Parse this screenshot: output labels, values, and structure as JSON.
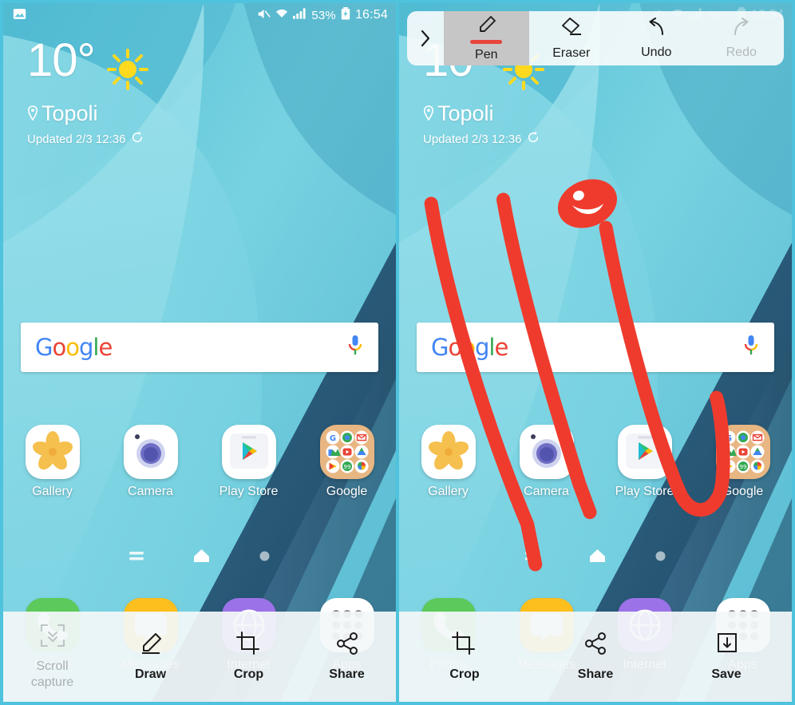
{
  "colors": {
    "accent_red": "#ef3b2d",
    "frame": "#4fc3dd",
    "toolbar_bg": "#f3f8f9",
    "selected_bg": "#c6c6c6",
    "pen_underline": "#e8453c",
    "wallpaper_base": "#63c6da"
  },
  "statusbar": {
    "gallery_icon": "image-icon",
    "mute_icon": "mute-icon",
    "wifi_icon": "wifi-icon",
    "signal_icon": "signal-bars-icon",
    "battery_percent": "53%",
    "battery_icon": "battery-charging-icon",
    "clock": "16:54"
  },
  "weather": {
    "temperature": "10°",
    "condition_icon": "sun-icon",
    "location_icon": "location-pin-icon",
    "location": "Topoli",
    "updated_label": "Updated 2/3  12:36",
    "refresh_icon": "refresh-icon"
  },
  "search": {
    "logo_letters": [
      "G",
      "o",
      "o",
      "g",
      "l",
      "e"
    ],
    "mic_icon": "microphone-icon"
  },
  "apps": [
    {
      "label": "Gallery",
      "icon": "gallery-flower-icon"
    },
    {
      "label": "Camera",
      "icon": "camera-lens-icon"
    },
    {
      "label": "Play Store",
      "icon": "play-store-icon"
    },
    {
      "label": "Google",
      "icon": "google-folder-icon"
    }
  ],
  "google_folder_apps": [
    "google-search-icon",
    "chrome-icon",
    "gmail-icon",
    "maps-icon",
    "youtube-icon",
    "drive-icon",
    "play-music-icon",
    "duo-icon",
    "photos-icon"
  ],
  "page_indicators": {
    "list_icon": "list-lines-icon",
    "home_icon": "home-icon",
    "dot_icon": "page-dot-icon"
  },
  "dock": [
    {
      "label": "Phone",
      "icon": "phone-icon"
    },
    {
      "label": "Messages",
      "icon": "messages-icon"
    },
    {
      "label": "Internet",
      "icon": "internet-globe-icon"
    },
    {
      "label": "Apps",
      "icon": "apps-grid-icon"
    }
  ],
  "left_panel": {
    "bottom_toolbar": [
      {
        "label": "Scroll\ncapture",
        "label_line1": "Scroll",
        "label_line2": "capture",
        "icon": "scroll-capture-icon",
        "enabled": false
      },
      {
        "label": "Draw",
        "icon": "draw-pen-icon",
        "enabled": true
      },
      {
        "label": "Crop",
        "icon": "crop-icon",
        "enabled": true
      },
      {
        "label": "Share",
        "icon": "share-icon",
        "enabled": true
      }
    ]
  },
  "right_panel": {
    "top_toolbar": {
      "expand_icon": "chevron-right-icon",
      "items": [
        {
          "label": "Pen",
          "icon": "pen-icon",
          "selected": true,
          "enabled": true
        },
        {
          "label": "Eraser",
          "icon": "eraser-icon",
          "selected": false,
          "enabled": true
        },
        {
          "label": "Undo",
          "icon": "undo-arrow-icon",
          "selected": false,
          "enabled": true
        },
        {
          "label": "Redo",
          "icon": "redo-arrow-icon",
          "selected": false,
          "enabled": false
        }
      ]
    },
    "bottom_toolbar": [
      {
        "label": "Crop",
        "icon": "crop-icon",
        "enabled": true
      },
      {
        "label": "Share",
        "icon": "share-icon",
        "enabled": true
      },
      {
        "label": "Save",
        "icon": "save-download-icon",
        "enabled": true
      }
    ],
    "annotation": {
      "tool": "Pen",
      "color": "#ef3b2d",
      "strokes": [
        "diagonal-stroke-1",
        "diagonal-stroke-2",
        "diagonal-stroke-3",
        "hook-stroke",
        "smiley-face"
      ]
    }
  }
}
